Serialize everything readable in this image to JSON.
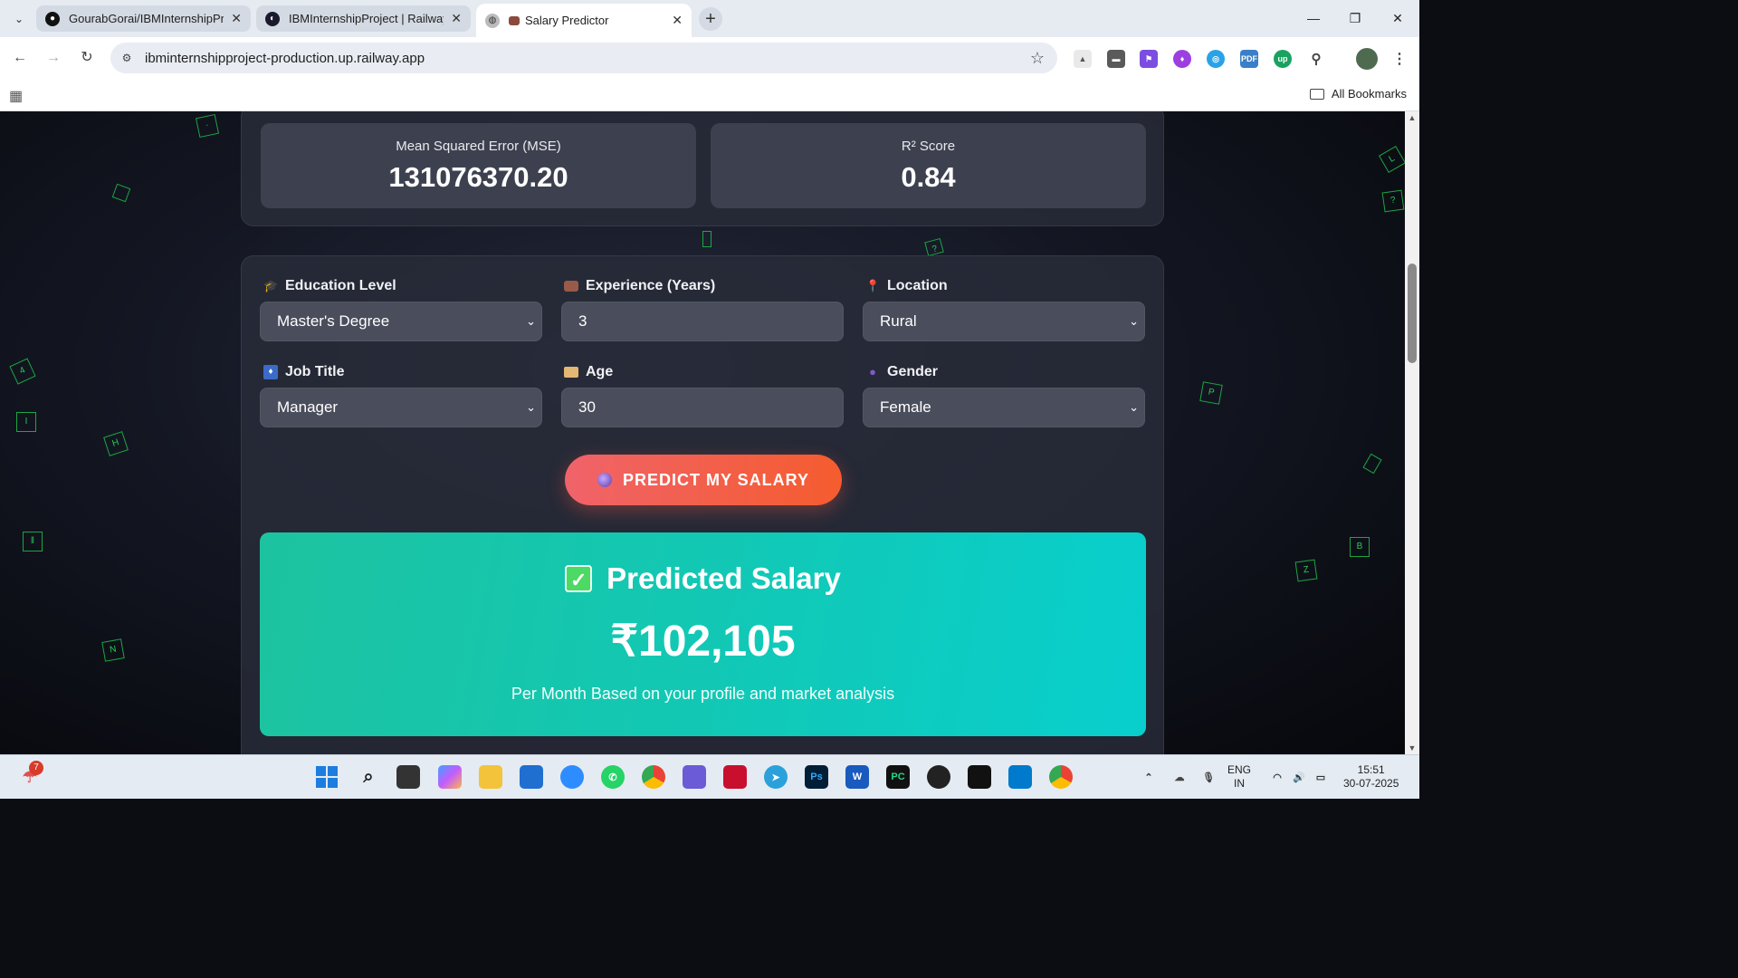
{
  "browser": {
    "tabs": [
      {
        "title": "GourabGorai/IBMInternshipProj",
        "close": "✕"
      },
      {
        "title": "IBMInternshipProject | Railway",
        "close": "✕"
      },
      {
        "title": "Salary Predictor",
        "close": "✕"
      }
    ],
    "new_tab": "+",
    "url": "ibminternshipproject-production.up.railway.app",
    "all_bookmarks": "All Bookmarks"
  },
  "metrics": {
    "mse_label": "Mean Squared Error (MSE)",
    "mse_value": "131076370.20",
    "r2_label": "R² Score",
    "r2_value": "0.84"
  },
  "form": {
    "education_label": "Education Level",
    "education_value": "Master's Degree",
    "experience_label": "Experience (Years)",
    "experience_value": "3",
    "location_label": "Location",
    "location_value": "Rural",
    "job_label": "Job Title",
    "job_value": "Manager",
    "age_label": "Age",
    "age_value": "30",
    "gender_label": "Gender",
    "gender_value": "Female",
    "predict_button": "PREDICT MY SALARY"
  },
  "result": {
    "heading": "Predicted Salary",
    "amount": "₹102,105",
    "subtitle": "Per Month Based on your profile and market analysis"
  },
  "background_glyphs": [
    "D",
    "L",
    "4",
    "I",
    "H",
    "N",
    "P",
    "B",
    "Z"
  ],
  "taskbar": {
    "notification_count": "7",
    "language": "ENG",
    "region": "IN",
    "time": "15:51",
    "date": "30-07-2025"
  },
  "colors": {
    "accent_button": "#f55c2e",
    "result_card": "#12c8b4",
    "floater_green": "#2ee65f"
  }
}
